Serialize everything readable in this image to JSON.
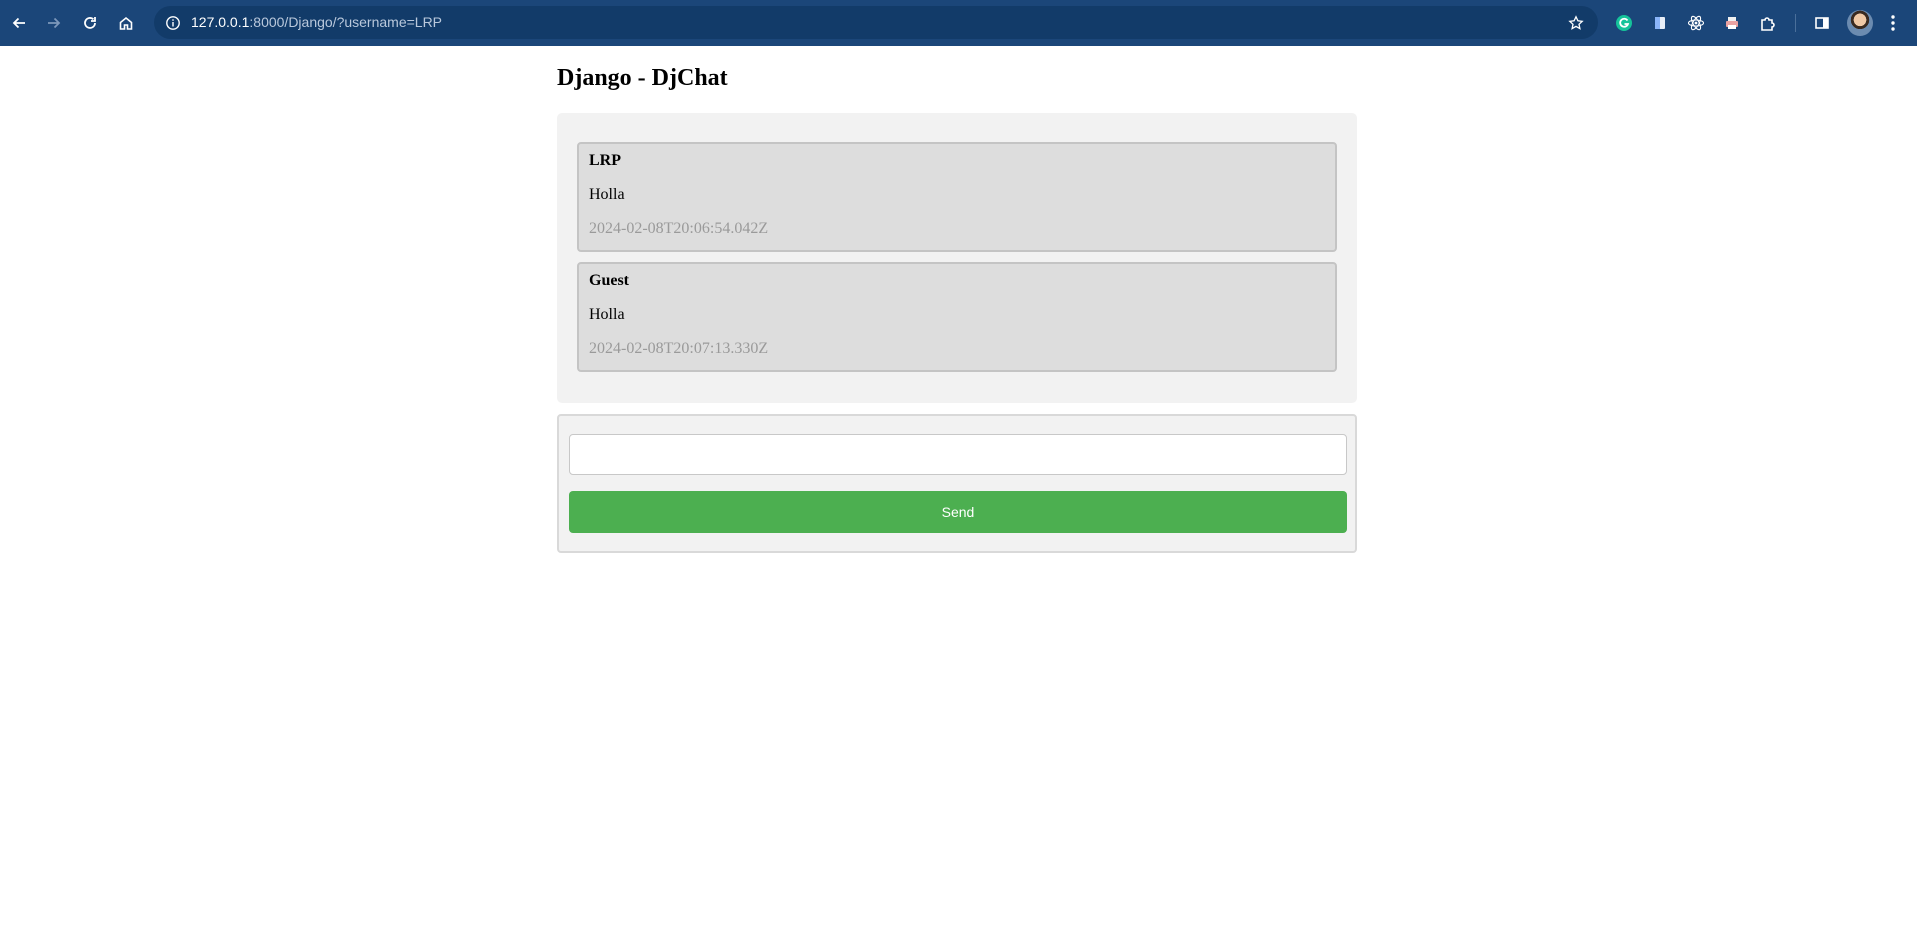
{
  "browser": {
    "url_host": "127.0.0.1",
    "url_rest": ":8000/Django/?username=LRP",
    "icons": [
      "back-icon",
      "forward-icon",
      "reload-icon",
      "home-icon",
      "site-info-icon",
      "bookmark-star-icon",
      "grammarly-icon",
      "docs-extension-icon",
      "react-devtools-icon",
      "print-extension-icon",
      "extensions-puzzle-icon",
      "side-panel-icon",
      "profile-avatar",
      "menu-kebab-icon"
    ],
    "colors": {
      "toolbar": "#1b4679",
      "omnibox": "#123b69"
    }
  },
  "page": {
    "title": "Django - DjChat"
  },
  "chat": {
    "messages": [
      {
        "user": "LRP",
        "text": "Holla",
        "timestamp": "2024-02-08T20:06:54.042Z"
      },
      {
        "user": "Guest",
        "text": "Holla",
        "timestamp": "2024-02-08T20:07:13.330Z"
      }
    ]
  },
  "form": {
    "input_value": "",
    "input_placeholder": "",
    "send_label": "Send",
    "send_color": "#4caf50"
  }
}
